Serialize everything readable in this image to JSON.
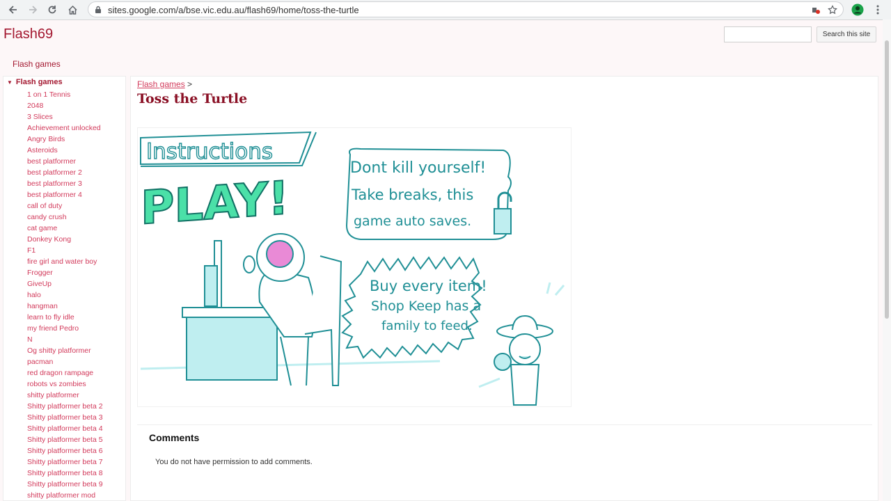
{
  "browser": {
    "url": "sites.google.com/a/bse.vic.edu.au/flash69/home/toss-the-turtle",
    "icons": [
      "back-icon",
      "forward-icon",
      "reload-icon",
      "home-icon",
      "lock-icon",
      "extension-icon",
      "star-icon",
      "profile-icon",
      "menu-icon"
    ]
  },
  "site": {
    "title": "Flash69",
    "search_button": "Search this site",
    "search_value": "",
    "nav_tab": "Flash games"
  },
  "sidebar": {
    "header": "Flash games",
    "items": [
      "1 on 1 Tennis",
      "2048",
      "3 Slices",
      "Achievement unlocked",
      "Angry Birds",
      "Asteroids",
      "best platformer",
      "best platformer 2",
      "best platformer 3",
      "best platformer 4",
      "call of duty",
      "candy crush",
      "cat game",
      "Donkey Kong",
      "F1",
      "fire girl and water boy",
      "Frogger",
      "GiveUp",
      "halo",
      "hangman",
      "learn to fly idle",
      "my friend Pedro",
      "N",
      "Og shitty platformer",
      "pacman",
      "red dragon rampage",
      "robots vs zombies",
      "shitty platformer",
      "Shitty platformer beta 2",
      "Shitty platformer beta 3",
      "Shitty platformer beta 4",
      "Shitty platformer beta 5",
      "Shitty platformer beta 6",
      "Shitty platformer beta 7",
      "Shitty platformer beta 8",
      "Shitty platformer beta 9",
      "shitty platformer mod"
    ]
  },
  "main": {
    "breadcrumb_link": "Flash games",
    "breadcrumb_sep": ">",
    "page_title": "Toss the Turtle",
    "game": {
      "heading": "Instructions",
      "play_button": "PLAY!",
      "tip1_line1": "Dont kill yourself!",
      "tip1_line2": "Take breaks, this",
      "tip1_line3": "game auto saves.",
      "tip2_line1": "Buy every item!",
      "tip2_line2": "Shop Keep has a",
      "tip2_line3": "family to feed."
    },
    "comments_title": "Comments",
    "comments_message": "You do not have permission to add comments."
  },
  "colors": {
    "brand": "#a3172f",
    "link": "#d23a5b",
    "game_line": "#1f8f95",
    "game_fill": "#bfeef0",
    "play_green": "#4be0a8"
  }
}
